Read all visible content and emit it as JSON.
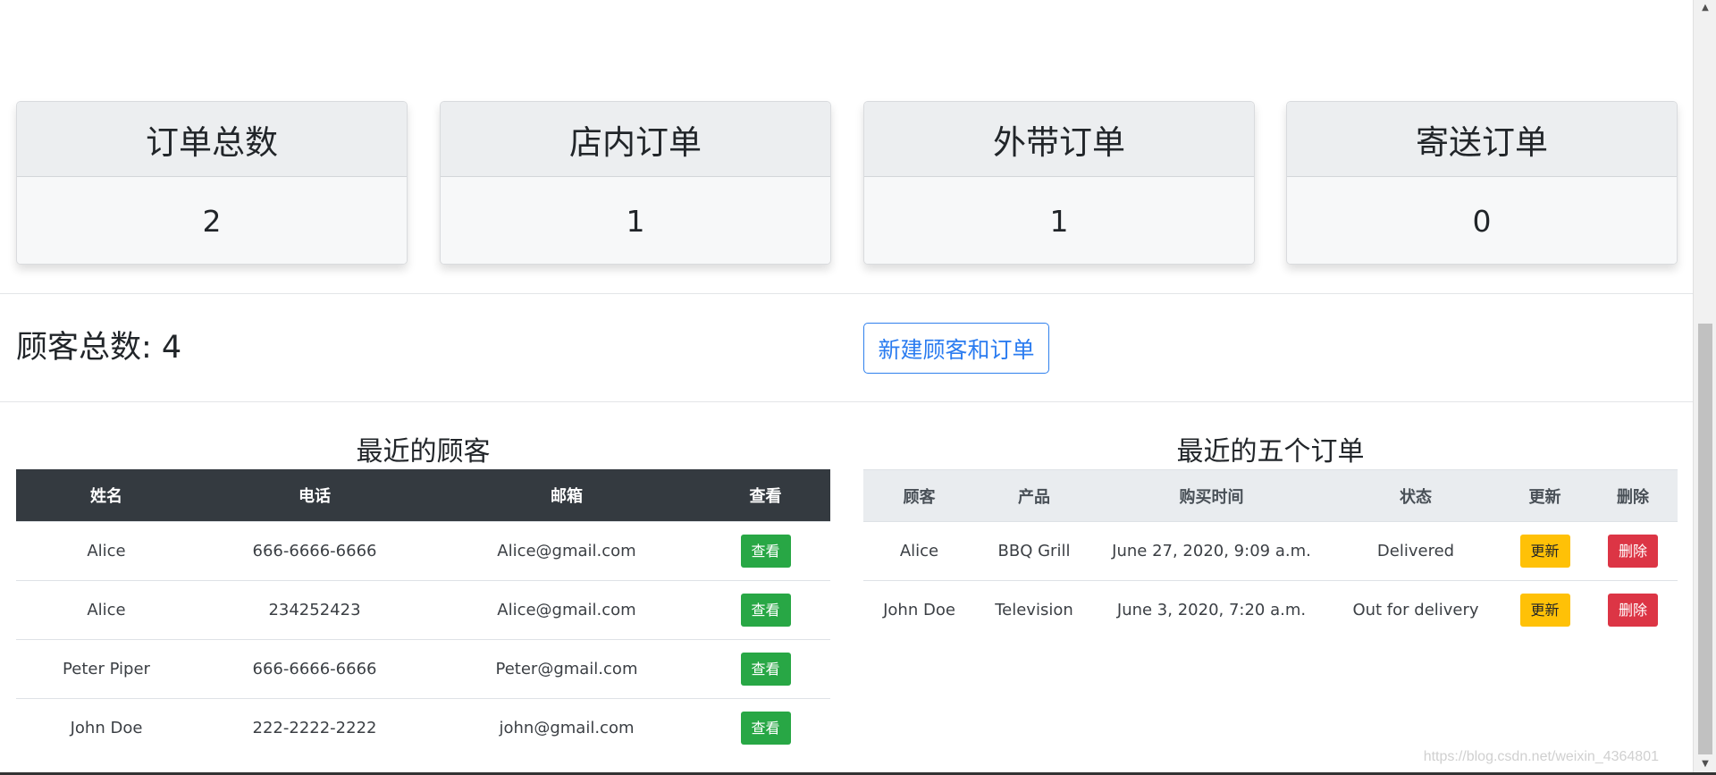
{
  "stats": [
    {
      "label": "订单总数",
      "value": "2"
    },
    {
      "label": "店内订单",
      "value": "1"
    },
    {
      "label": "外带订单",
      "value": "1"
    },
    {
      "label": "寄送订单",
      "value": "0"
    }
  ],
  "customers_total": "顾客总数: 4",
  "new_button": "新建顾客和订单",
  "recent_customers": {
    "title": "最近的顾客",
    "headers": [
      "姓名",
      "电话",
      "邮箱",
      "查看"
    ],
    "rows": [
      {
        "name": "Alice",
        "phone": "666-6666-6666",
        "email": "Alice@gmail.com",
        "action": "查看"
      },
      {
        "name": "Alice",
        "phone": "234252423",
        "email": "Alice@gmail.com",
        "action": "查看"
      },
      {
        "name": "Peter Piper",
        "phone": "666-6666-6666",
        "email": "Peter@gmail.com",
        "action": "查看"
      },
      {
        "name": "John Doe",
        "phone": "222-2222-2222",
        "email": "john@gmail.com",
        "action": "查看"
      }
    ]
  },
  "recent_orders": {
    "title": "最近的五个订单",
    "headers": [
      "顾客",
      "产品",
      "购买时间",
      "状态",
      "更新",
      "删除"
    ],
    "rows": [
      {
        "customer": "Alice",
        "product": "BBQ Grill",
        "date": "June 27, 2020, 9:09 a.m.",
        "status": "Delivered",
        "update": "更新",
        "delete": "删除"
      },
      {
        "customer": "John Doe",
        "product": "Television",
        "date": "June 3, 2020, 7:20 a.m.",
        "status": "Out for delivery",
        "update": "更新",
        "delete": "删除"
      }
    ]
  },
  "watermark": "https://blog.csdn.net/weixin_4364801",
  "colors": {
    "dark_header": "#343a40",
    "view_button": "#28a745",
    "update_button": "#ffc107",
    "delete_button": "#dc3545",
    "primary_outline": "#2f80ed"
  }
}
